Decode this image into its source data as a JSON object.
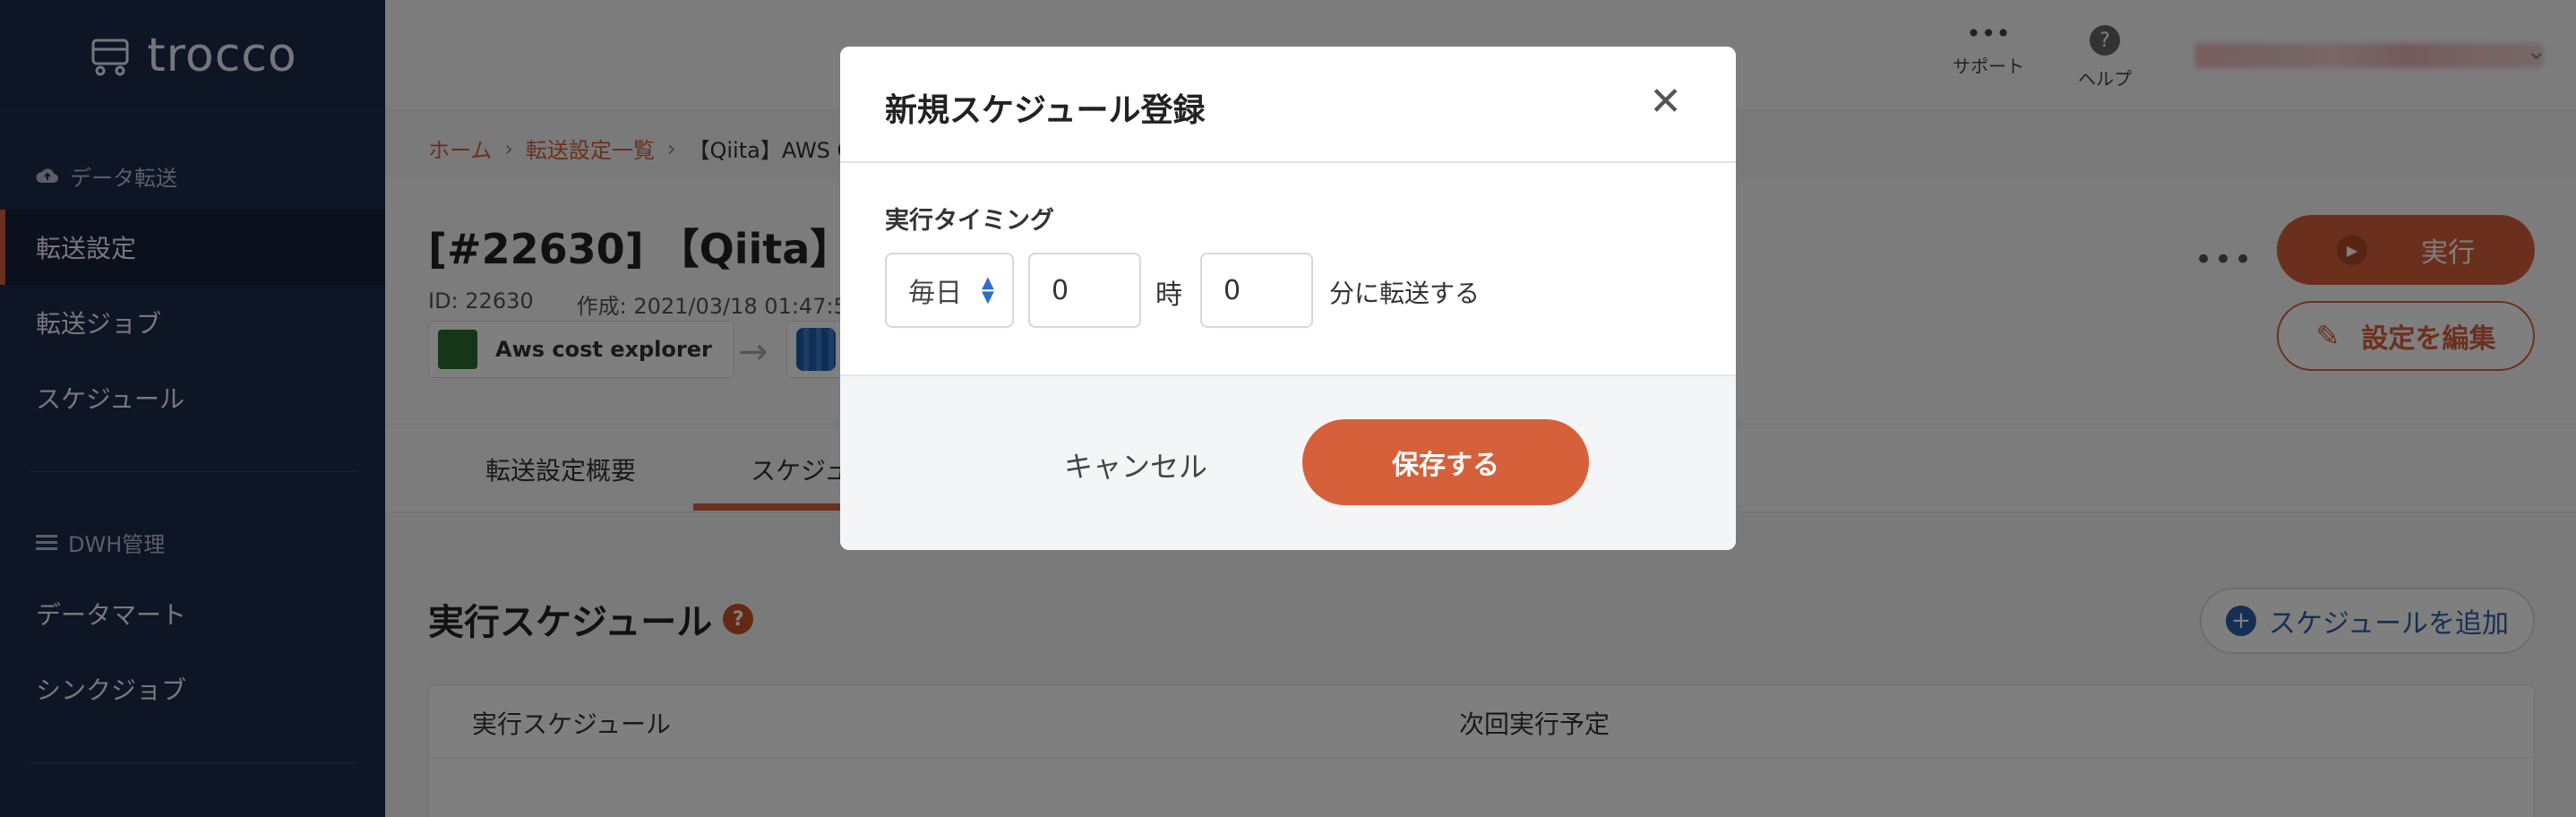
{
  "app": {
    "logo_text": "trocco"
  },
  "sidebar": {
    "section1": "データ転送",
    "items1": [
      "転送設定",
      "転送ジョブ",
      "スケジュール"
    ],
    "section2": "DWH管理",
    "items2": [
      "データマート",
      "シンクジョブ"
    ]
  },
  "header": {
    "support": "サポート",
    "help": "ヘルプ"
  },
  "breadcrumb": {
    "home": "ホーム",
    "list": "転送設定一覧",
    "current": "【Qiita】AWS C"
  },
  "page": {
    "title": "[#22630] 【Qiita】A",
    "id": "ID: 22630",
    "created": "作成: 2021/03/18 01:47:5",
    "source_connector": "Aws cost explorer",
    "run_label": "実行",
    "edit_label": "設定を編集"
  },
  "tabs": [
    "転送設定概要",
    "スケジュ"
  ],
  "schedule": {
    "title": "実行スケジュール",
    "add_label": "スケジュールを追加",
    "col1": "実行スケジュール",
    "col2": "次回実行予定"
  },
  "modal": {
    "title": "新規スケジュール登録",
    "timing_label": "実行タイミング",
    "frequency": "毎日",
    "hour_value": "0",
    "hour_unit": "時",
    "minute_value": "0",
    "minute_unit": "分に転送する",
    "cancel_label": "キャンセル",
    "save_label": "保存する"
  },
  "colors": {
    "accent": "#d6603a",
    "sidebar": "#1d2b4a",
    "link_blue": "#2c5fa8"
  }
}
